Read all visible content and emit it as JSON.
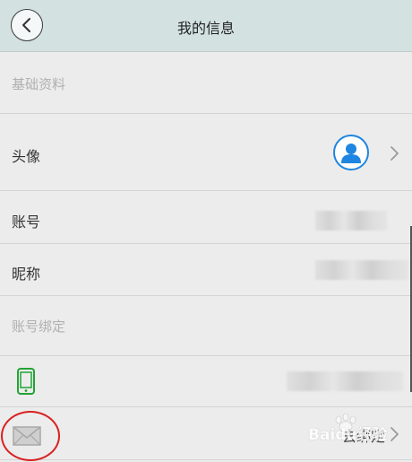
{
  "header": {
    "title": "我的信息",
    "back_icon": "chevron-left-icon"
  },
  "sections": {
    "basic_info": "基础资料",
    "account_binding": "账号绑定"
  },
  "rows": {
    "avatar": {
      "label": "头像",
      "icon": "user-avatar-icon"
    },
    "account": {
      "label": "账号",
      "value": ""
    },
    "nickname": {
      "label": "昵称",
      "value": ""
    },
    "phone": {
      "icon": "mobile-phone-icon",
      "value": ""
    },
    "email": {
      "icon": "mail-icon",
      "status": "去绑定"
    }
  },
  "watermark": {
    "text": "Baidu经验"
  },
  "colors": {
    "header_bg": "#d3e1e1",
    "avatar_blue": "#1e86e0",
    "phone_green": "#22a334",
    "highlight_red": "#d92020"
  }
}
